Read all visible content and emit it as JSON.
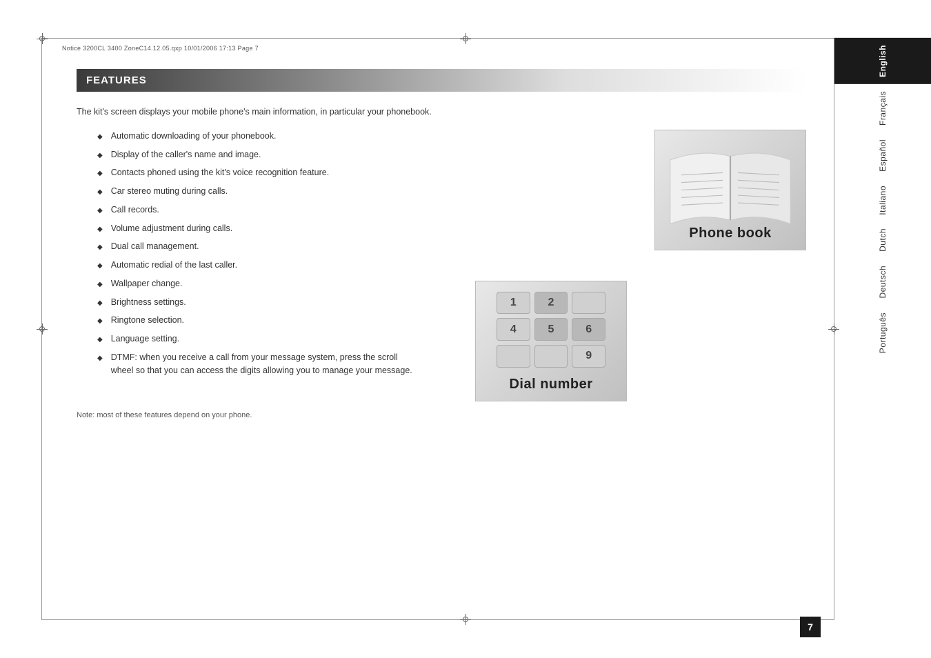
{
  "page": {
    "title": "Features Page",
    "page_number": "7",
    "header_text": "Notice 3200CL 3400 ZoneC14.12.05.qxp   10/01/2006   17:13   Page 7"
  },
  "features": {
    "section_title": "FEATURES",
    "intro": "The kit's screen displays your mobile phone's main information, in particular your phonebook.",
    "bullets": [
      "Automatic downloading of your phonebook.",
      "Display of the caller's name and image.",
      "Contacts phoned using the kit's voice recognition feature.",
      "Car stereo muting during calls.",
      "Call records.",
      "Volume adjustment during calls.",
      "Dual call management.",
      "Automatic redial of the last caller.",
      "Wallpaper change.",
      "Brightness settings.",
      "Ringtone selection.",
      "Language setting.",
      "DTMF: when you receive a call from your message system, press the scroll wheel so that you can access the digits allowing you to manage your message."
    ],
    "note": "Note: most of these features depend on your phone.",
    "phonebook_label": "Phone book",
    "dialnumber_label": "Dial number"
  },
  "languages": {
    "active": "English",
    "items": [
      "English",
      "Français",
      "Español",
      "Italiano",
      "Dutch",
      "Deutsch",
      "Português"
    ]
  }
}
